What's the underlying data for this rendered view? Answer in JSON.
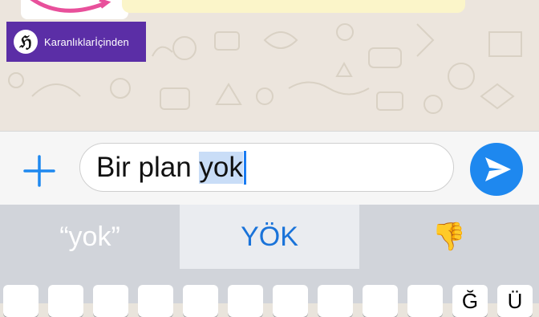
{
  "watermark": {
    "text": "Karanlıklarİçinden",
    "logo_glyph": "ℌ"
  },
  "composer": {
    "text_plain": "Bir plan ",
    "text_selected": "yok",
    "add_icon": "plus-icon",
    "send_icon": "send-arrow-icon"
  },
  "suggestions": [
    {
      "label": "“yok”"
    },
    {
      "label": "YÖK"
    },
    {
      "label": "👎"
    }
  ],
  "keyboard": {
    "visible_keys": [
      "",
      "",
      "",
      "",
      "",
      "",
      "",
      "",
      "",
      "",
      "Ğ",
      "Ü"
    ]
  },
  "colors": {
    "accent": "#1e88ef",
    "watermark_bg": "#5b2ea6",
    "highlight": "#c9ddf7"
  }
}
